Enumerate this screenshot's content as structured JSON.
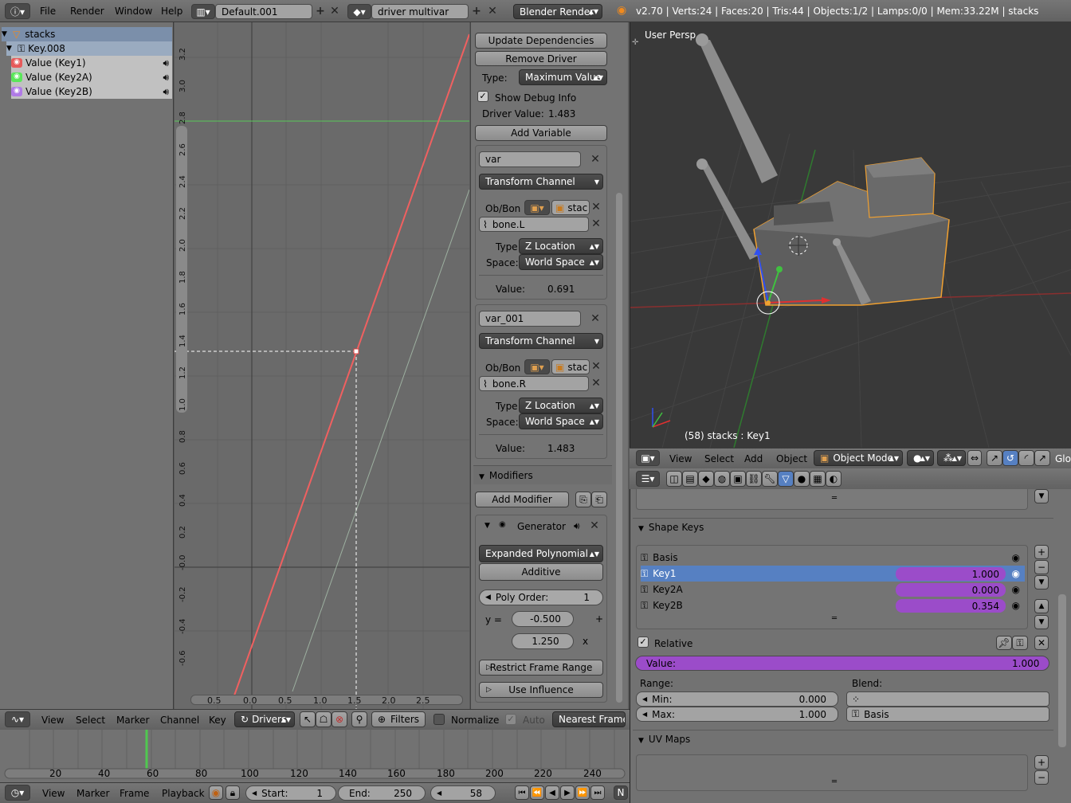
{
  "topbar": {
    "menus": [
      "File",
      "Render",
      "Window",
      "Help"
    ],
    "screen_layout": "Default.001",
    "scene": "driver multivar",
    "render_engine": "Blender Render",
    "stats": "v2.70 | Verts:24 | Faces:20 | Tris:44 | Objects:1/2 | Lamps:0/0 | Mem:33.22M | stacks"
  },
  "channels": {
    "object": "stacks",
    "key": "Key.008",
    "items": [
      {
        "label": "Value (Key1)",
        "color": "#e65a5a"
      },
      {
        "label": "Value (Key2A)",
        "color": "#5ae65a"
      },
      {
        "label": "Value (Key2B)",
        "color": "#b07ae6"
      }
    ]
  },
  "graph": {
    "y_ticks": [
      "3.2",
      "3.0",
      "2.8",
      "2.6",
      "2.4",
      "2.2",
      "2.0",
      "1.8",
      "1.6",
      "1.4",
      "1.2",
      "1.0",
      "0.8",
      "0.6",
      "0.4",
      "0.2",
      "-0.0",
      "-0.2",
      "-0.4",
      "-0.6"
    ],
    "x_ticks": [
      "0.5",
      "0.0",
      "0.5",
      "1.0",
      "1.5",
      "2.0",
      "2.5"
    ],
    "cursor_x": 1.5,
    "cursor_y": 1.35
  },
  "driver": {
    "update_label": "Update Dependencies",
    "remove_label": "Remove Driver",
    "type_label": "Type:",
    "type_value": "Maximum Value",
    "debug_label": "Show Debug Info",
    "value_label": "Driver Value:",
    "value": "1.483",
    "add_var": "Add Variable"
  },
  "vars": [
    {
      "name": "var",
      "kind": "Transform Channel",
      "obbon": "Ob/Bon",
      "obj": "stac",
      "bone": "bone.L",
      "type_label": "Type:",
      "type": "Z Location",
      "space_label": "Space:",
      "space": "World Space",
      "value_label": "Value:",
      "value": "0.691"
    },
    {
      "name": "var_001",
      "kind": "Transform Channel",
      "obbon": "Ob/Bon",
      "obj": "stac",
      "bone": "bone.R",
      "type_label": "Type:",
      "type": "Z Location",
      "space_label": "Space:",
      "space": "World Space",
      "value_label": "Value:",
      "value": "1.483"
    }
  ],
  "modifiers": {
    "title": "Modifiers",
    "add": "Add Modifier",
    "gen": "Generator",
    "mode": "Expanded Polynomial",
    "additive": "Additive",
    "poly_label": "Poly Order:",
    "poly": "1",
    "y_eq": "y =",
    "c0": "-0.500",
    "plus": "+",
    "c1": "1.250",
    "x": "x",
    "restrict": "Restrict Frame Range",
    "influence": "Use Influence"
  },
  "graph_header": {
    "menus": [
      "View",
      "Select",
      "Marker",
      "Channel",
      "Key"
    ],
    "mode": "Drivers",
    "filters": "Filters",
    "normalize": "Normalize",
    "auto": "Auto",
    "nearest": "Nearest Frame"
  },
  "viewport": {
    "persp": "User Persp",
    "info": "(58) stacks : Key1",
    "menus": [
      "View",
      "Select",
      "Add",
      "Object"
    ],
    "mode": "Object Mode",
    "glob": "Glob"
  },
  "shapekeys": {
    "title": "Shape Keys",
    "keys": [
      {
        "name": "Basis",
        "value": ""
      },
      {
        "name": "Key1",
        "value": "1.000"
      },
      {
        "name": "Key2A",
        "value": "0.000"
      },
      {
        "name": "Key2B",
        "value": "0.354"
      }
    ],
    "relative": "Relative",
    "value_label": "Value:",
    "value": "1.000",
    "range": "Range:",
    "min_label": "Min:",
    "min": "0.000",
    "max_label": "Max:",
    "max": "1.000",
    "blend": "Blend:",
    "blend_value": "Basis",
    "uv": "UV Maps"
  },
  "timeline": {
    "ticks": [
      "20",
      "40",
      "60",
      "80",
      "100",
      "120",
      "140",
      "160",
      "180",
      "200",
      "220",
      "240"
    ],
    "menus": [
      "View",
      "Marker",
      "Frame",
      "Playback"
    ],
    "start_label": "Start:",
    "start": "1",
    "end_label": "End:",
    "end": "250",
    "current": "58",
    "n": "N"
  }
}
